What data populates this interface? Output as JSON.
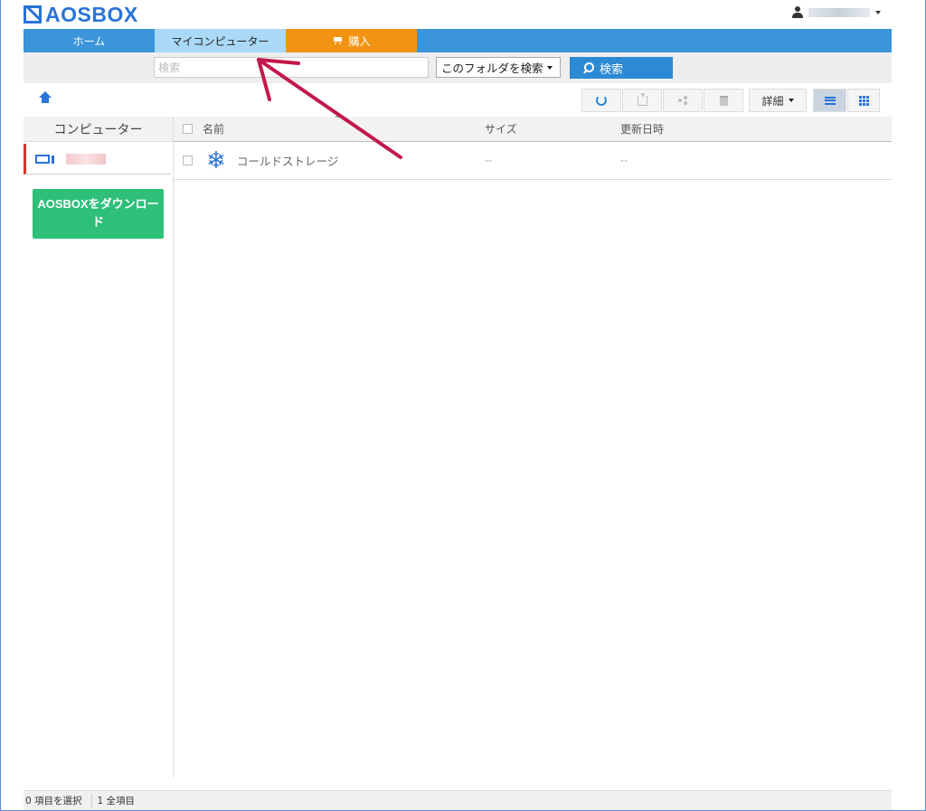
{
  "app": {
    "logo_text": "AOSBOX"
  },
  "nav": {
    "tabs": [
      {
        "label": "ホーム"
      },
      {
        "label": "マイコンピューター"
      },
      {
        "label": "購入"
      }
    ]
  },
  "search": {
    "placeholder": "検索",
    "scope_label": "このフォルダを検索",
    "button_label": "検索"
  },
  "toolbar": {
    "detail_label": "詳細"
  },
  "sidebar": {
    "header": "コンピューター",
    "download_button": "AOSBOXをダウンロード"
  },
  "file_list": {
    "columns": [
      "名前",
      "サイズ",
      "更新日時"
    ],
    "rows": [
      {
        "name": "コールドストレージ",
        "size": "--",
        "modified": "--",
        "icon": "snowflake-icon"
      }
    ]
  },
  "status": {
    "selected": "0 項目を選択",
    "total": "1 全項目"
  },
  "colors": {
    "brand_blue": "#2a73d9",
    "nav_blue": "#3b95d8",
    "active_tab": "#a9d9f7",
    "buy_orange": "#f29412",
    "download_green": "#2ebf79",
    "annotation_arrow": "#c2184a"
  }
}
